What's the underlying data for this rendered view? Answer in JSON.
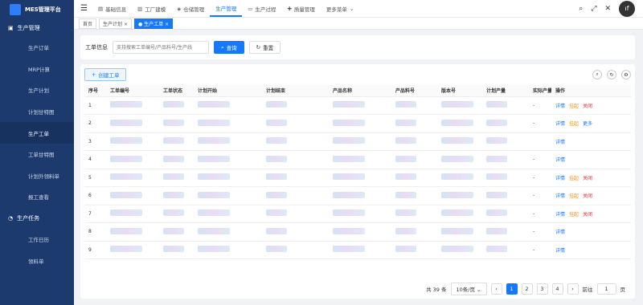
{
  "app": {
    "title": "MES管理平台"
  },
  "sidebar": {
    "group": "生产管理",
    "items": [
      "生产订单",
      "MRP计算",
      "生产计划",
      "计划甘特图",
      "生产工单",
      "工单甘特图",
      "计划外领料单",
      "报工查看"
    ],
    "group2": "生产任务",
    "items2": [
      "工作日历",
      "领料单"
    ]
  },
  "nav": [
    "基础信息",
    "工厂建模",
    "仓储管理",
    "生产管理",
    "生产过程",
    "质量管理",
    "更多菜单"
  ],
  "tabs": [
    "首页",
    "生产计划",
    "生产工单"
  ],
  "search": {
    "label": "工单信息",
    "placeholder": "支持搜索工单编号/产品料号/生产线",
    "query_btn": "查询",
    "reset_btn": "重置"
  },
  "toolbar": {
    "create_btn": "创建工单"
  },
  "table": {
    "headers": [
      "序号",
      "工单编号",
      "工单状态",
      "计划开始",
      "计划结束",
      "产品名称",
      "产品料号",
      "版本号",
      "计划产量",
      "实际产量",
      "操作"
    ],
    "rows": [
      {
        "no": "1",
        "actual": "-",
        "ops": [
          "详情",
          "挂起",
          "关闭"
        ]
      },
      {
        "no": "2",
        "actual": "-",
        "ops": [
          "详情",
          "挂起",
          "更多"
        ]
      },
      {
        "no": "3",
        "actual": "",
        "ops": [
          "详情"
        ]
      },
      {
        "no": "4",
        "actual": "-",
        "ops": [
          "详情"
        ]
      },
      {
        "no": "5",
        "actual": "-",
        "ops": [
          "详情",
          "挂起",
          "关闭"
        ]
      },
      {
        "no": "6",
        "actual": "-",
        "ops": [
          "详情",
          "挂起",
          "关闭"
        ]
      },
      {
        "no": "7",
        "actual": "-",
        "ops": [
          "详情",
          "挂起",
          "关闭"
        ]
      },
      {
        "no": "8",
        "actual": "-",
        "ops": [
          "详情"
        ]
      },
      {
        "no": "9",
        "actual": "-",
        "ops": [
          "详情"
        ]
      }
    ]
  },
  "pager": {
    "total": "共 39 条",
    "size": "10条/页",
    "pages": [
      "1",
      "2",
      "3",
      "4"
    ],
    "goto": "前往",
    "page_input": "1",
    "page_unit": "页"
  }
}
